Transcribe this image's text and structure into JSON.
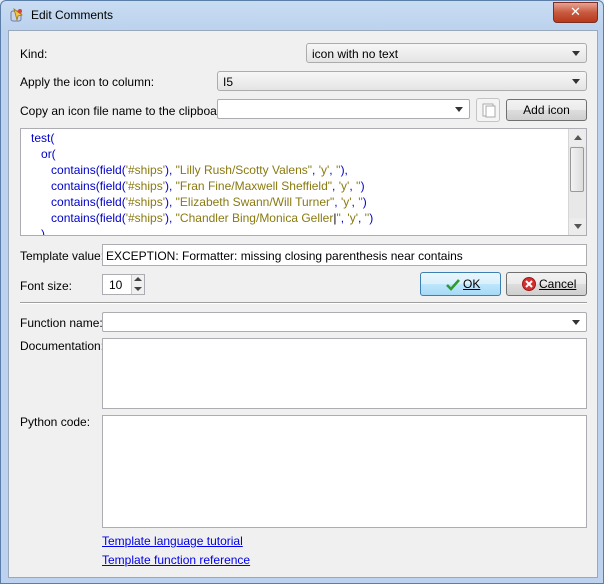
{
  "window": {
    "title": "Edit Comments",
    "close_label": "✕"
  },
  "kind": {
    "label": "Kind:",
    "value": "icon with no text"
  },
  "apply_column": {
    "label": "Apply the icon to column:",
    "value": "I5"
  },
  "copy_icon": {
    "label": "Copy an icon file name to the clipboard:",
    "value": "",
    "add_icon_label": "Add icon"
  },
  "code_lines": [
    {
      "indent": "   ",
      "parts": [
        {
          "t": "test(",
          "c": "kw"
        }
      ]
    },
    {
      "indent": "      ",
      "parts": [
        {
          "t": "or(",
          "c": "kw"
        }
      ]
    },
    {
      "indent": "         ",
      "parts": [
        {
          "t": "contains(field(",
          "c": "kw"
        },
        {
          "t": "'#ships'",
          "c": "str"
        },
        {
          "t": "), ",
          "c": "kw"
        },
        {
          "t": "\"Lilly Rush/Scotty Valens\"",
          "c": "str"
        },
        {
          "t": ", ",
          "c": "kw"
        },
        {
          "t": "'y'",
          "c": "str"
        },
        {
          "t": ", ",
          "c": "kw"
        },
        {
          "t": "''",
          "c": "str"
        },
        {
          "t": "),",
          "c": "kw"
        }
      ]
    },
    {
      "indent": "         ",
      "parts": [
        {
          "t": "contains(field(",
          "c": "kw"
        },
        {
          "t": "'#ships'",
          "c": "str"
        },
        {
          "t": "), ",
          "c": "kw"
        },
        {
          "t": "\"Fran Fine/Maxwell Sheffield\"",
          "c": "str"
        },
        {
          "t": ", ",
          "c": "kw"
        },
        {
          "t": "'y'",
          "c": "str"
        },
        {
          "t": ", ",
          "c": "kw"
        },
        {
          "t": "''",
          "c": "str"
        },
        {
          "t": ")",
          "c": "kw"
        }
      ]
    },
    {
      "indent": "         ",
      "parts": [
        {
          "t": "contains(field(",
          "c": "kw"
        },
        {
          "t": "'#ships'",
          "c": "str"
        },
        {
          "t": "), ",
          "c": "kw"
        },
        {
          "t": "\"Elizabeth Swann/Will Turner\"",
          "c": "str"
        },
        {
          "t": ", ",
          "c": "kw"
        },
        {
          "t": "'y'",
          "c": "str"
        },
        {
          "t": ", ",
          "c": "kw"
        },
        {
          "t": "''",
          "c": "str"
        },
        {
          "t": ")",
          "c": "kw"
        }
      ]
    },
    {
      "indent": "         ",
      "parts": [
        {
          "t": "contains(field(",
          "c": "kw"
        },
        {
          "t": "'#ships'",
          "c": "str"
        },
        {
          "t": "), ",
          "c": "kw"
        },
        {
          "t": "\"Chandler Bing/Monica Geller",
          "c": "str"
        },
        {
          "t": "|",
          "c": "plain"
        },
        {
          "t": "\"",
          "c": "str"
        },
        {
          "t": ", ",
          "c": "kw"
        },
        {
          "t": "'y'",
          "c": "str"
        },
        {
          "t": ", ",
          "c": "kw"
        },
        {
          "t": "''",
          "c": "str"
        },
        {
          "t": ")",
          "c": "kw"
        }
      ]
    },
    {
      "indent": "      ",
      "parts": [
        {
          "t": ")",
          "c": "kw"
        }
      ]
    }
  ],
  "template_value": {
    "label": "Template value:",
    "value": "EXCEPTION:  Formatter: missing closing parenthesis near  contains"
  },
  "font_size": {
    "label": "Font size:",
    "value": "10"
  },
  "buttons": {
    "ok": "OK",
    "cancel": "Cancel"
  },
  "function_name": {
    "label": "Function name:",
    "value": ""
  },
  "documentation": {
    "label": "Documentation:"
  },
  "python_code": {
    "label": "Python code:"
  },
  "links": {
    "tutorial": "Template language tutorial",
    "reference": "Template function reference"
  },
  "colors": {
    "keyword": "#0000c8",
    "string": "#8a7a10"
  }
}
